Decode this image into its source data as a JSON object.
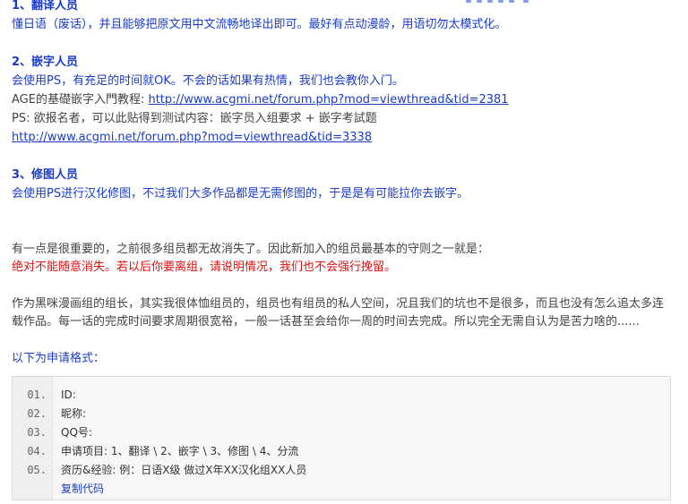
{
  "sections": {
    "translator": {
      "heading": "1、翻译人员",
      "desc": "懂日语（废话），并且能够把原文用中文流畅地译出即可。最好有点动漫龄，用语切勿太模式化。"
    },
    "typesetter": {
      "heading": "2、嵌字人员",
      "desc": "会使用PS，有充足的时间就OK。不会的话如果有热情，我们也会教你入门。",
      "tutorial_prefix": "AGE的基礎嵌字入門教程: ",
      "tutorial_link": "http://www.acgmi.net/forum.php?mod=viewthread&tid=2381",
      "ps_note": "PS: 欲报名者，可以此贴得到测试内容：嵌字员入组要求 + 嵌字考試题",
      "test_link": "http://www.acgmi.net/forum.php?mod=viewthread&tid=3338"
    },
    "retoucher": {
      "heading": "3、修图人员",
      "desc": "会使用PS进行汉化修图，不过我们大多作品都是无需修图的，于是是有可能拉你去嵌字。"
    }
  },
  "rules": {
    "intro": "有一点是很重要的，之前很多组员都无故消失了。因此新加入的组员最基本的守则之一就是：",
    "warning": "绝对不能随意消失。若以后你要离组，请说明情况，我们也不会强行挽留。",
    "note_line1": "作为黑咪漫画组的组长，其实我很体恤组员的，组员也有组员的私人空间，况且我们的坑也不是很多，而且也没有怎么追太多连",
    "note_line2": "载作品。每一话的完成时间要求周期很宽裕，一般一话甚至会给你一周的时间去完成。所以完全无需自认为是苦力啥的......"
  },
  "application": {
    "label": "以下为申请格式：",
    "lines": [
      {
        "num": "01.",
        "text": "ID:"
      },
      {
        "num": "02.",
        "text": "昵称:"
      },
      {
        "num": "03.",
        "text": "QQ号:"
      },
      {
        "num": "04.",
        "text": "申请项目:  1、翻译 \\ 2、嵌字 \\ 3、修图 \\ 4、分流"
      },
      {
        "num": "05.",
        "text": "资历&经验:  例：日语X级      做过X年XX汉化组XX人员"
      }
    ],
    "copy_label": "复制代码"
  },
  "colors": {
    "heading": "#1a3cc6",
    "link": "#1a3cc6",
    "warning": "#e01010",
    "text": "#444444"
  }
}
